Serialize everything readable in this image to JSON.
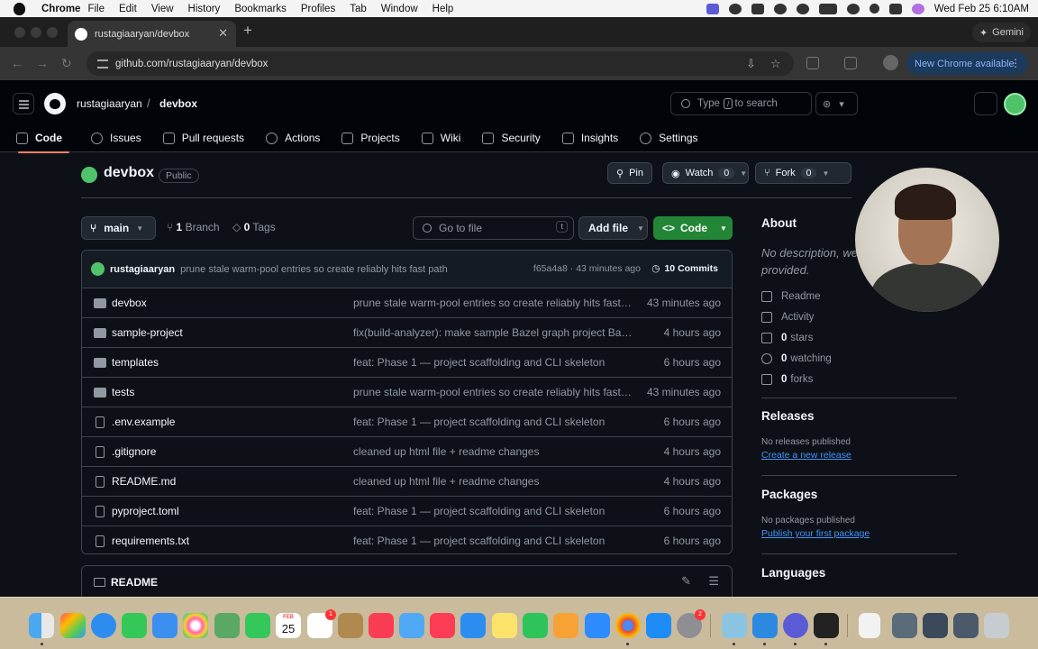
{
  "menubar": {
    "app": "Chrome",
    "items": [
      "File",
      "Edit",
      "View",
      "History",
      "Bookmarks",
      "Profiles",
      "Tab",
      "Window",
      "Help"
    ],
    "clock": "Wed Feb 25  6:10AM"
  },
  "browser": {
    "tab_title": "rustagiaaryan/devbox",
    "url": "github.com/rustagiaaryan/devbox",
    "gemini_label": "Gemini",
    "update_label": "New Chrome available"
  },
  "github": {
    "owner": "rustagiaaryan",
    "repo": "devbox",
    "search_pre": "Type",
    "search_key": "/",
    "search_post": "to search",
    "tabs": [
      {
        "label": "Code",
        "icon": "code-icon"
      },
      {
        "label": "Issues",
        "icon": "issue-icon"
      },
      {
        "label": "Pull requests",
        "icon": "pull-request-icon"
      },
      {
        "label": "Actions",
        "icon": "play-icon"
      },
      {
        "label": "Projects",
        "icon": "table-icon"
      },
      {
        "label": "Wiki",
        "icon": "book-icon"
      },
      {
        "label": "Security",
        "icon": "shield-icon"
      },
      {
        "label": "Insights",
        "icon": "graph-icon"
      },
      {
        "label": "Settings",
        "icon": "gear-icon"
      }
    ],
    "visibility": "Public",
    "pin_label": "Pin",
    "watch_label": "Watch",
    "watch_count": "0",
    "fork_label": "Fork",
    "fork_count": "0",
    "branch": "main",
    "branch_count": "1",
    "branch_word": "Branch",
    "tag_count": "0",
    "tag_word": "Tags",
    "gofile_placeholder": "Go to file",
    "gofile_key": "t",
    "addfile_label": "Add file",
    "code_label": "Code",
    "commit": {
      "author": "rustagiaaryan",
      "message": "prune stale warm-pool entries so create reliably hits fast path",
      "meta": "f65a4a8 · 43 minutes ago",
      "commits_label": "10 Commits"
    },
    "files": [
      {
        "name": "devbox",
        "type": "dir",
        "message": "prune stale warm-pool entries so create reliably hits fast p...",
        "time": "43 minutes ago"
      },
      {
        "name": "sample-project",
        "type": "dir",
        "message": "fix(build-analyzer): make sample Bazel graph project Baze...",
        "time": "4 hours ago"
      },
      {
        "name": "templates",
        "type": "dir",
        "message": "feat: Phase 1 — project scaffolding and CLI skeleton",
        "time": "6 hours ago"
      },
      {
        "name": "tests",
        "type": "dir",
        "message": "prune stale warm-pool entries so create reliably hits fast p...",
        "time": "43 minutes ago"
      },
      {
        "name": ".env.example",
        "type": "file",
        "message": "feat: Phase 1 — project scaffolding and CLI skeleton",
        "time": "6 hours ago"
      },
      {
        "name": ".gitignore",
        "type": "file",
        "message": "cleaned up html file + readme changes",
        "time": "4 hours ago"
      },
      {
        "name": "README.md",
        "type": "file",
        "message": "cleaned up html file + readme changes",
        "time": "4 hours ago"
      },
      {
        "name": "pyproject.toml",
        "type": "file",
        "message": "feat: Phase 1 — project scaffolding and CLI skeleton",
        "time": "6 hours ago"
      },
      {
        "name": "requirements.txt",
        "type": "file",
        "message": "feat: Phase 1 — project scaffolding and CLI skeleton",
        "time": "6 hours ago"
      }
    ],
    "readme_title": "README",
    "about": {
      "title": "About",
      "description": "No description, website, or topics provided.",
      "readme": "Readme",
      "activity": "Activity",
      "stars_count": "0",
      "stars_word": "stars",
      "watching_count": "0",
      "watching_word": "watching",
      "forks_count": "0",
      "forks_word": "forks"
    },
    "releases": {
      "title": "Releases",
      "empty": "No releases published",
      "link": "Create a new release"
    },
    "packages": {
      "title": "Packages",
      "empty": "No packages published",
      "link": "Publish your first package"
    },
    "languages": {
      "title": "Languages"
    }
  },
  "dock": {
    "calendar_month": "FEB",
    "calendar_day": "25",
    "badges": {
      "reminders": "1",
      "chatgpt": "2"
    }
  }
}
